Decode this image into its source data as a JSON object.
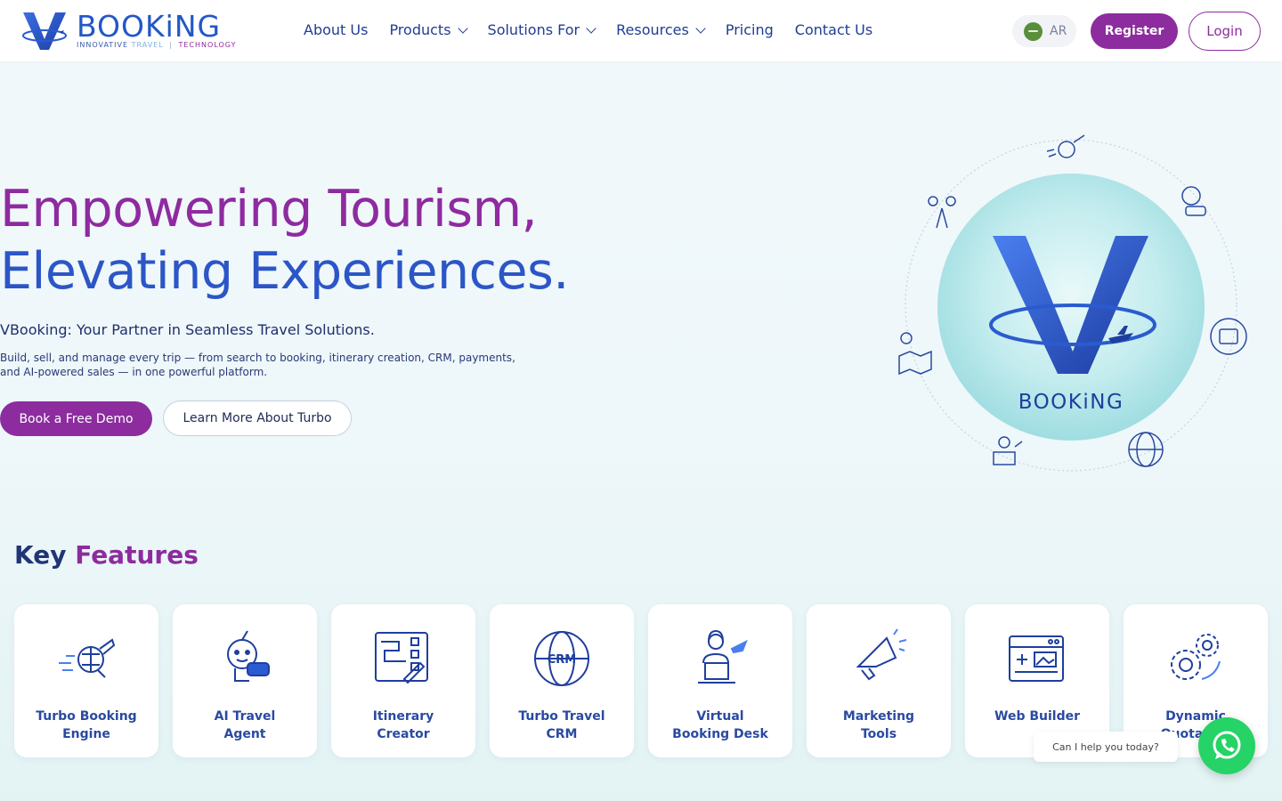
{
  "logo": {
    "word": "BOOKiNG",
    "tagline_1": "INNOVATIVE",
    "tagline_2": "TRAVEL",
    "tagline_sep": "|",
    "tagline_3": "TECHNOLOGY"
  },
  "nav": {
    "items": [
      {
        "label": "About Us",
        "dropdown": false
      },
      {
        "label": "Products",
        "dropdown": true
      },
      {
        "label": "Solutions For",
        "dropdown": true
      },
      {
        "label": "Resources",
        "dropdown": true
      },
      {
        "label": "Pricing",
        "dropdown": false
      },
      {
        "label": "Contact Us",
        "dropdown": false
      }
    ]
  },
  "header": {
    "lang_label": "AR",
    "register_label": "Register",
    "login_label": "Login"
  },
  "hero": {
    "title_line1": "Empowering Tourism,",
    "title_line2": "Elevating Experiences.",
    "subtitle": "VBooking: Your Partner in Seamless Travel Solutions.",
    "description": "Build, sell, and manage every trip — from search to booking, itinerary creation, CRM, payments, and AI-powered sales — in one powerful platform.",
    "demo_label": "Book a Free Demo",
    "learn_label": "Learn More About Turbo",
    "graphic_word": "BOOKiNG"
  },
  "features": {
    "title_a": "Key",
    "title_b": "Features",
    "items": [
      {
        "line1": "Turbo Booking",
        "line2": "Engine",
        "icon": "rocket-globe-icon"
      },
      {
        "line1": "AI Travel",
        "line2": "Agent",
        "icon": "robot-agent-icon"
      },
      {
        "line1": "Itinerary",
        "line2": "Creator",
        "icon": "itinerary-map-icon"
      },
      {
        "line1": "Turbo Travel",
        "line2": "CRM",
        "icon": "crm-globe-icon"
      },
      {
        "line1": "Virtual",
        "line2": "Booking Desk",
        "icon": "agent-desk-icon"
      },
      {
        "line1": "Marketing",
        "line2": "Tools",
        "icon": "megaphone-icon"
      },
      {
        "line1": "Web Builder",
        "line2": "",
        "icon": "web-builder-icon"
      },
      {
        "line1": "Dynamic",
        "line2": "Quotation",
        "icon": "gears-icon"
      }
    ]
  },
  "chat": {
    "bubble_text": "Can I help you today?"
  },
  "colors": {
    "brand_purple": "#8c2c9e",
    "brand_blue": "#2c56c7",
    "whatsapp_green": "#25d366"
  }
}
